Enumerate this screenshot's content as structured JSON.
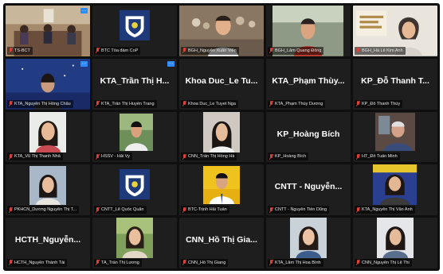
{
  "accent_colors": {
    "active_speaker": "#e8d33a",
    "more_button": "#2d8cff",
    "muted_mic": "#e0403a"
  },
  "participants": [
    {
      "name": "",
      "label": "TS-BCT"
    },
    {
      "name": "",
      "label": "BTC Tòa đàm CoP"
    },
    {
      "name": "",
      "label": "BGH_Nguyễn Xuân Viên"
    },
    {
      "name": "",
      "label": "BGH_Lâm Quang Đông"
    },
    {
      "name": "",
      "label": "BGH_Hà Lê Kim Anh"
    },
    {
      "name": "",
      "label": "KTA_Nguyễn Thị Hồng Châu"
    },
    {
      "name": "KTA_Trần Thị H...",
      "label": "KTA_Trần Thị Huyền Trang"
    },
    {
      "name": "Khoa Duc_Le Tu...",
      "label": "Khoa Duc_Le Tuyet Nga"
    },
    {
      "name": "KTA_Phạm Thùy...",
      "label": "KTA_Phạm Thùy Dương"
    },
    {
      "name": "KP_Đỗ Thanh T...",
      "label": "KP_Đỗ Thanh Thủy"
    },
    {
      "name": "",
      "label": "KTA_Vũ Thị Thanh Nhã"
    },
    {
      "name": "",
      "label": "HSSV - Hải Vy"
    },
    {
      "name": "",
      "label": "CNN_Trần Thị Hồng Hà"
    },
    {
      "name": "KP_Hoàng Bích",
      "label": "KP_Hoàng Bích"
    },
    {
      "name": "",
      "label": "HT_Đỗ Tuấn Minh"
    },
    {
      "name": "",
      "label": "PKHCN_Dương Nguyễn Thị T..."
    },
    {
      "name": "",
      "label": "CNTT_Lê Quốc Quân"
    },
    {
      "name": "",
      "label": "BTC-Trịnh Hải Tuấn"
    },
    {
      "name": "CNTT - Nguyễn...",
      "label": "CNTT - Nguyễn Tiến Dũng"
    },
    {
      "name": "",
      "label": "KTA_Nguyễn Thị Vân Anh"
    },
    {
      "name": "HCTH_Nguyễn...",
      "label": "HCTH_Nguyễn Thành Tài"
    },
    {
      "name": "",
      "label": "TA_Trần Thị Lương"
    },
    {
      "name": "CNN_Hồ Thị Gia...",
      "label": "CNN_Hồ Thị Giang"
    },
    {
      "name": "",
      "label": "KTA_Lâm Thị Hoa Bình"
    },
    {
      "name": "",
      "label": "CNN_Nguyễn Thị Lệ Thi"
    }
  ]
}
